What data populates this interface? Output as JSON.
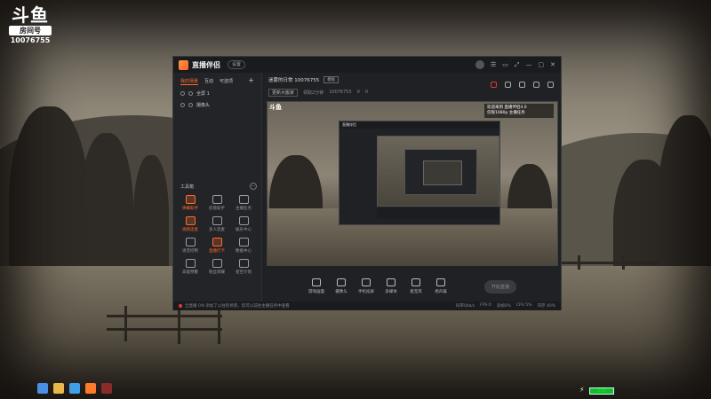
{
  "douyu": {
    "logo_text": "斗鱼",
    "room_label": "房间号",
    "room_number": "10076755"
  },
  "app": {
    "name": "直播伴侣",
    "chip": "设置",
    "window_controls": [
      "☰",
      "▭",
      "⤢",
      "—",
      "▢",
      "✕"
    ]
  },
  "left": {
    "tabs": [
      "我的场景",
      "互动",
      "可选项"
    ],
    "plus": "+",
    "scenes": [
      "全屏 1",
      "摄像头"
    ],
    "tools_title": "工具箱",
    "tools_more": "⋯",
    "tools": [
      "弹幕助手",
      "房管助手",
      "主播任务",
      "视频连麦",
      "多人连麦",
      "娱乐中心",
      "语音控制",
      "直播打卡",
      "数据中心",
      "高能预警",
      "粉丝荣耀",
      "星空计划"
    ]
  },
  "center": {
    "room_title": "迷雾的日常 10076755",
    "room_tag": "模板",
    "sub_items": [
      "更新大搬家",
      "领取2分钟",
      "10076755",
      "0",
      "0"
    ],
    "preview_notice_lines": [
      "欢迎来到 直播伴侣4.0",
      "仅限1080p 主播任务"
    ],
    "inner_title": "直播伴侣",
    "controls": [
      "游戏画面",
      "摄像头",
      "手机投屏",
      "多媒体",
      "麦克风",
      "扬声器"
    ],
    "go_live": "开始直播"
  },
  "statusbar": {
    "message": "全直播 ON 添加了以往的场景，您可以前往主播任务中查看",
    "right_items": [
      "码率0kb/s",
      "FPS:0",
      "丢帧0%",
      "CPU 5%",
      "内存 40%"
    ]
  },
  "taskbar": {
    "battery": "100"
  },
  "colors": {
    "accent": "#ff6a2b",
    "alert": "#e53935",
    "window_bg": "#202124"
  }
}
